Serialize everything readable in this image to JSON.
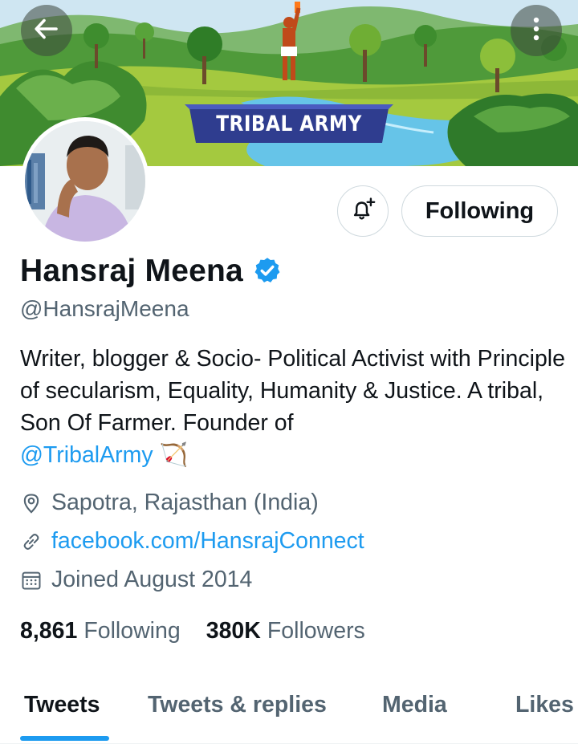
{
  "banner": {
    "title": "TRIBAL ARMY",
    "colors": {
      "sky": "#b7dcef",
      "hills": "#4f9a3a",
      "grass": "#a4c93f",
      "river": "#66c4e8",
      "title_bg": "#2f3d8f"
    }
  },
  "header": {
    "back_icon": "arrow-left-icon",
    "more_icon": "more-vertical-icon"
  },
  "profile": {
    "display_name": "Hansraj Meena",
    "verified": true,
    "handle": "@HansrajMeena",
    "bio_text": "Writer, blogger & Socio- Political Activist with Principle of secularism, Equality, Humanity & Justice. A tribal, Son Of Farmer. Founder of",
    "bio_mention": "@TribalArmy",
    "bio_emoji": "🏹",
    "location": "Sapotra, Rajasthan (India)",
    "website": "facebook.com/HansrajConnect",
    "joined": "Joined August 2014"
  },
  "actions": {
    "notify_icon": "bell-plus-icon",
    "following_label": "Following"
  },
  "stats": {
    "following_count": "8,861",
    "following_label": "Following",
    "followers_count": "380K",
    "followers_label": "Followers"
  },
  "tabs": [
    {
      "label": "Tweets",
      "active": true
    },
    {
      "label": "Tweets & replies",
      "active": false
    },
    {
      "label": "Media",
      "active": false
    },
    {
      "label": "Likes",
      "active": false
    }
  ],
  "colors": {
    "accent": "#1d9bf0",
    "text": "#0f1419",
    "secondary": "#536471",
    "border": "#cfd9de"
  }
}
